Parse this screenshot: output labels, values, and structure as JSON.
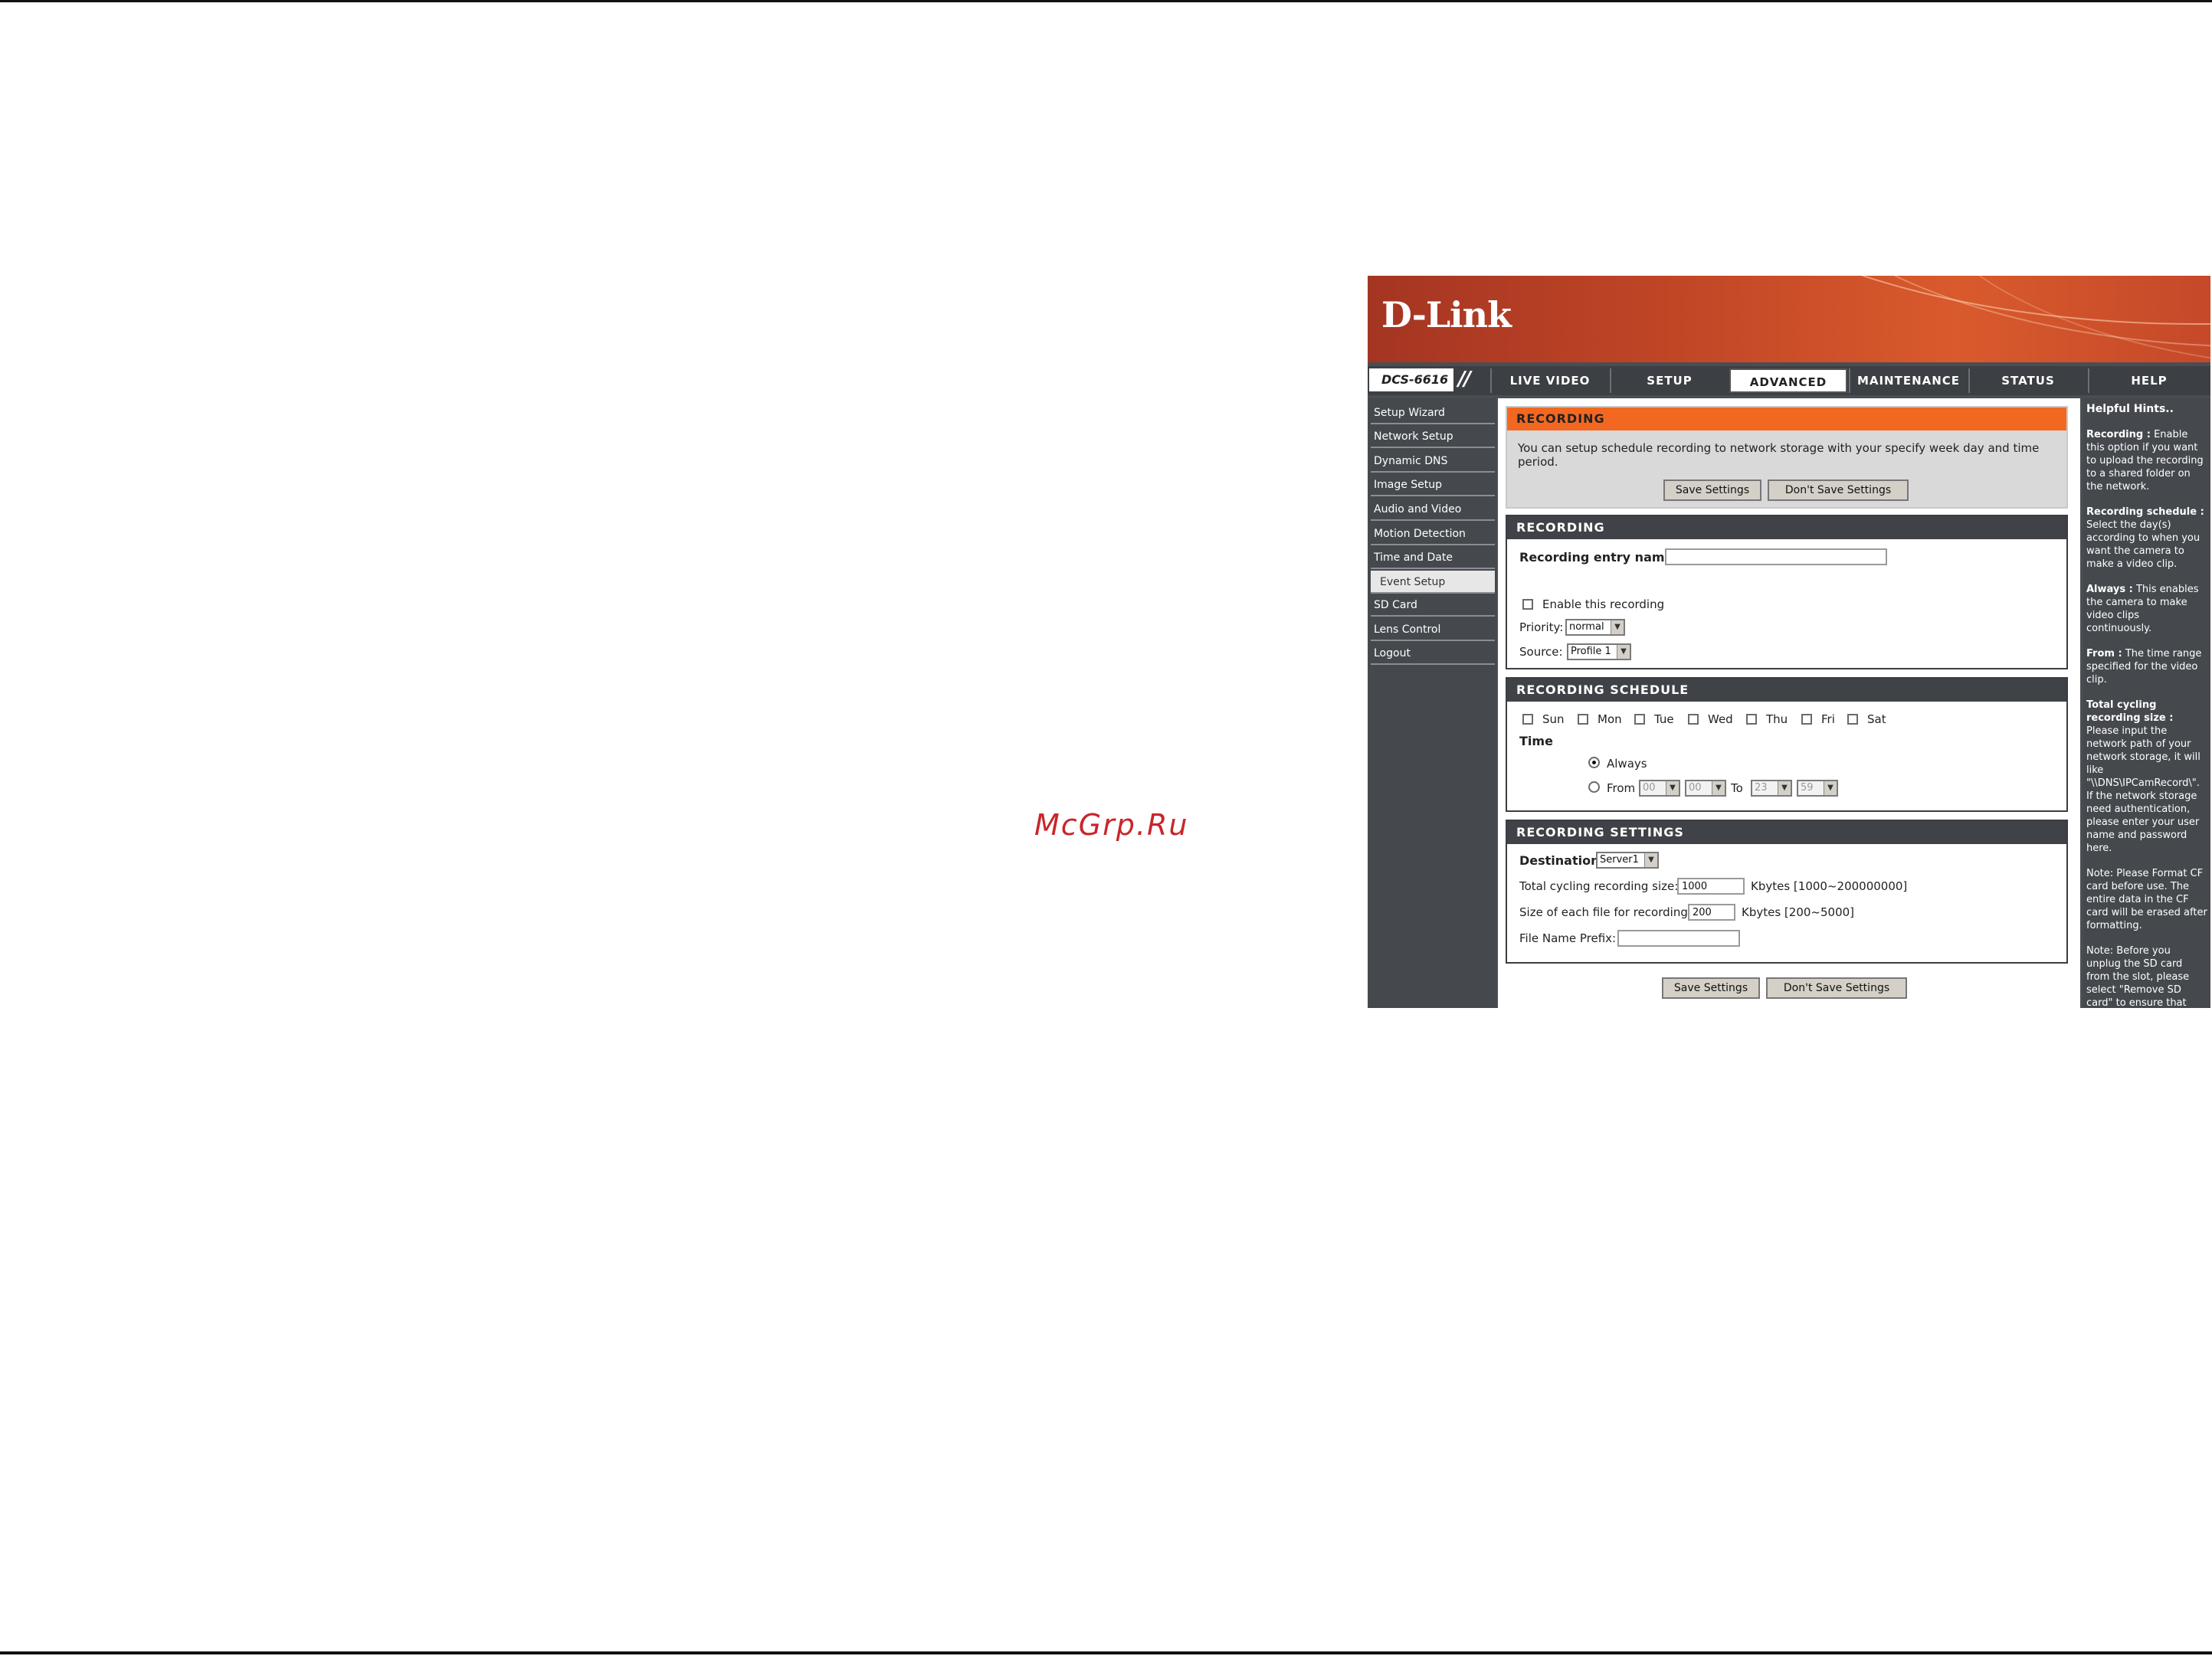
{
  "watermark": "McGrp.Ru",
  "brand": {
    "logo": "D-Link",
    "model": "DCS-6616"
  },
  "nav": {
    "tabs": [
      {
        "label": "LIVE VIDEO"
      },
      {
        "label": "SETUP"
      },
      {
        "label": "ADVANCED"
      },
      {
        "label": "MAINTENANCE"
      },
      {
        "label": "STATUS"
      },
      {
        "label": "HELP"
      }
    ],
    "active": "ADVANCED"
  },
  "sidebar": {
    "items": [
      {
        "label": "Setup Wizard"
      },
      {
        "label": "Network Setup"
      },
      {
        "label": "Dynamic DNS"
      },
      {
        "label": "Image Setup"
      },
      {
        "label": "Audio and Video"
      },
      {
        "label": "Motion Detection"
      },
      {
        "label": "Time and Date"
      },
      {
        "label": "Event Setup"
      },
      {
        "label": "SD Card"
      },
      {
        "label": "Lens Control"
      },
      {
        "label": "Logout"
      }
    ],
    "active": "Event Setup"
  },
  "intro": {
    "title": "RECORDING",
    "text": "You can setup schedule recording to network storage with your specify week day and time period.",
    "save_label": "Save Settings",
    "dont_save_label": "Don't Save Settings"
  },
  "recording": {
    "title": "RECORDING",
    "entry_name_label": "Recording entry name:",
    "entry_name_value": "",
    "enable_label": "Enable this recording",
    "enable_checked": false,
    "priority_label": "Priority:",
    "priority_value": "normal",
    "source_label": "Source:",
    "source_value": "Profile 1"
  },
  "schedule": {
    "title": "RECORDING SCHEDULE",
    "days": [
      "Sun",
      "Mon",
      "Tue",
      "Wed",
      "Thu",
      "Fri",
      "Sat"
    ],
    "time_label": "Time",
    "always_label": "Always",
    "always_selected": true,
    "from_label": "From",
    "to_label": "To",
    "from_hour": "00",
    "from_minute": "00",
    "to_hour": "23",
    "to_minute": "59"
  },
  "settings": {
    "title": "RECORDING SETTINGS",
    "destination_label": "Destination",
    "destination_value": "Server1",
    "total_size_label": "Total cycling recording size:",
    "total_size_value": "1000",
    "total_size_unit": "Kbytes [1000~200000000]",
    "file_size_label": "Size of each file for recording:",
    "file_size_value": "200",
    "file_size_unit": "Kbytes [200~5000]",
    "prefix_label": "File Name Prefix:",
    "prefix_value": ""
  },
  "footer": {
    "save_label": "Save Settings",
    "dont_save_label": "Don't Save Settings"
  },
  "hints": {
    "title": "Helpful Hints..",
    "items": [
      {
        "term": "Recording :",
        "text": "Enable this option if you want to upload the recording to a shared folder on the network."
      },
      {
        "term": "Recording schedule :",
        "text": "Select the day(s) according to when you want the camera to make a video clip."
      },
      {
        "term": "Always :",
        "text": "This enables the camera to make video clips continuously."
      },
      {
        "term": "From :",
        "text": "The time range specified for the video clip."
      },
      {
        "term": "Total cycling recording size :",
        "text": "Please input the network path of your network storage, it will like \"\\\\DNS\\IPCamRecord\\\". If the network storage need authentication, please enter your user name and password here."
      },
      {
        "term": "",
        "text": "Note: Please Format CF card before use. The entire data in the CF card will be erased after formatting."
      },
      {
        "term": "",
        "text": "Note: Before you unplug the SD card from the slot, please select \"Remove SD card\" to ensure that your data is secure."
      }
    ]
  }
}
